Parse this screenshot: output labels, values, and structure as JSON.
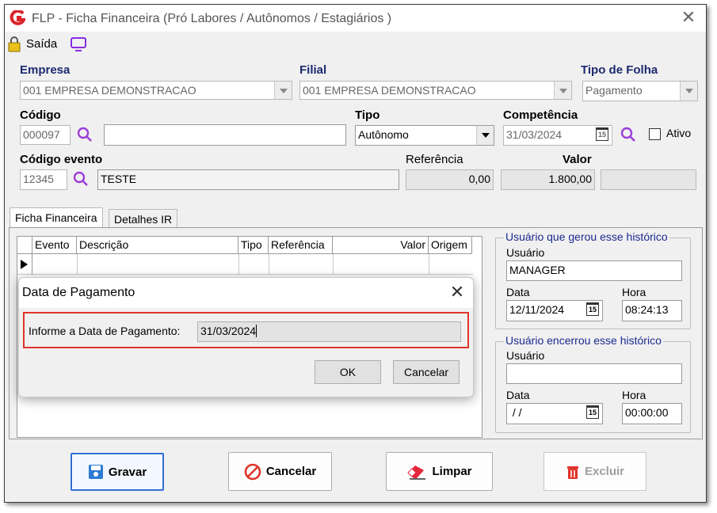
{
  "window": {
    "title": "FLP - Ficha Financeira (Pró Labores / Autônomos / Estagiários )"
  },
  "toolbar": {
    "exit_label": "Saída"
  },
  "empresa": {
    "label": "Empresa",
    "value": "001 EMPRESA DEMONSTRACAO"
  },
  "filial": {
    "label": "Filial",
    "value": "001 EMPRESA DEMONSTRACAO"
  },
  "tipo_folha": {
    "label": "Tipo de Folha",
    "value": "Pagamento"
  },
  "codigo": {
    "label": "Código",
    "value": "000097",
    "name": ""
  },
  "tipo": {
    "label": "Tipo",
    "value": "Autônomo"
  },
  "competencia": {
    "label": "Competência",
    "value": "31/03/2024",
    "cal_label": "15"
  },
  "ativo": {
    "label": "Ativo",
    "checked": false
  },
  "evento": {
    "label": "Código evento",
    "code": "12345",
    "description": "TESTE"
  },
  "referencia": {
    "label": "Referência",
    "value": "0,00"
  },
  "valor": {
    "label": "Valor",
    "value": "1.800,00"
  },
  "tabs": [
    {
      "label": "Ficha Financeira"
    },
    {
      "label": "Detalhes IR"
    }
  ],
  "grid": {
    "columns": [
      "Evento",
      "Descrição",
      "Tipo",
      "Referência",
      "Valor",
      "Origem"
    ]
  },
  "gerou": {
    "title": "Usuário que gerou esse histórico",
    "usuario_label": "Usuário",
    "usuario": "MANAGER",
    "data_label": "Data",
    "data": "12/11/2024",
    "hora_label": "Hora",
    "hora": "08:24:13"
  },
  "encerrou": {
    "title": "Usuário encerrou esse histórico",
    "usuario_label": "Usuário",
    "usuario": "",
    "data_label": "Data",
    "data": " / /",
    "hora_label": "Hora",
    "hora": "00:00:00"
  },
  "dialog": {
    "title": "Data de Pagamento",
    "prompt": "Informe a Data de Pagamento:",
    "value": "31/03/2024",
    "ok": "OK",
    "cancel": "Cancelar"
  },
  "buttons": {
    "save": "Gravar",
    "cancel": "Cancelar",
    "clear": "Limpar",
    "delete": "Excluir"
  },
  "colors": {
    "accent": "#1b2a6e",
    "highlight": "#e0342c",
    "search": "#9b40d8"
  }
}
